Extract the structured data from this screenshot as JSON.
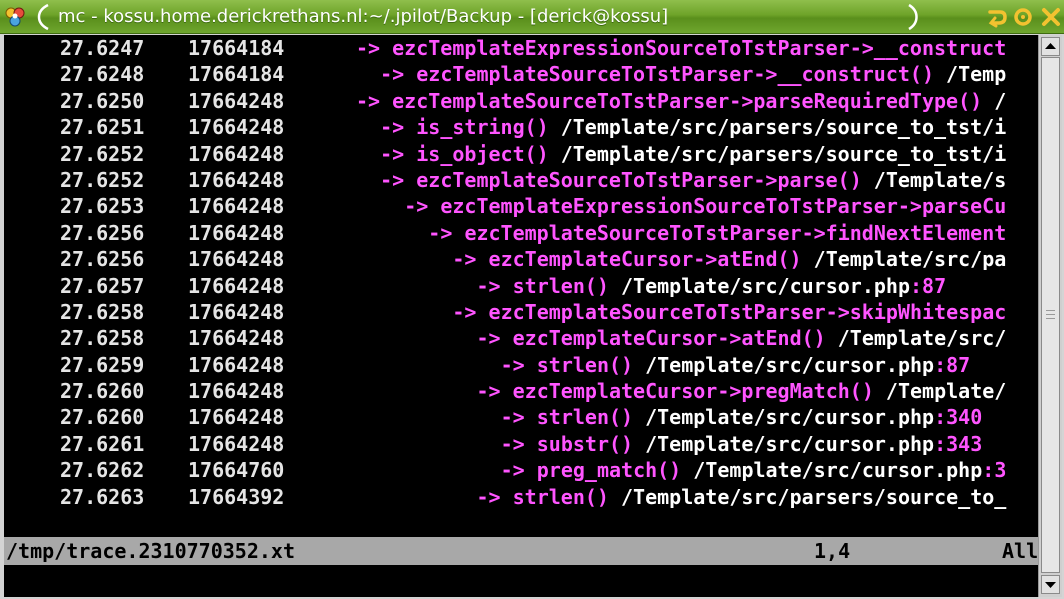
{
  "window": {
    "title": "mc - kossu.home.derickrethans.nl:~/.jpilot/Backup - [derick@kossu]",
    "icons": [
      "app-icon",
      "shade-icon",
      "maximize-icon",
      "close-icon"
    ]
  },
  "terminal": {
    "colors": {
      "background": "#000000",
      "text": "#e5e5e5",
      "magenta": "#ff55ff",
      "white": "#ffffff",
      "status_bg": "#a8a8a8"
    },
    "lines": [
      {
        "time": "27.6247",
        "mem": "17664184",
        "indent": 0,
        "arrow": "->",
        "func": "ezcTemplateExpressionSourceToTstParser->__construct",
        "path": "",
        "colon": "",
        "lineno": ""
      },
      {
        "time": "27.6248",
        "mem": "17664184",
        "indent": 1,
        "arrow": "->",
        "func": "ezcTemplateSourceToTstParser->__construct()",
        "path": " /Temp",
        "colon": "",
        "lineno": ""
      },
      {
        "time": "27.6250",
        "mem": "17664248",
        "indent": 0,
        "arrow": "->",
        "func": "ezcTemplateSourceToTstParser->parseRequiredType()",
        "path": " /",
        "colon": "",
        "lineno": ""
      },
      {
        "time": "27.6251",
        "mem": "17664248",
        "indent": 1,
        "arrow": "->",
        "func": "is_string()",
        "path": " /Template/src/parsers/source_to_tst/i",
        "colon": "",
        "lineno": ""
      },
      {
        "time": "27.6252",
        "mem": "17664248",
        "indent": 1,
        "arrow": "->",
        "func": "is_object()",
        "path": " /Template/src/parsers/source_to_tst/i",
        "colon": "",
        "lineno": ""
      },
      {
        "time": "27.6252",
        "mem": "17664248",
        "indent": 1,
        "arrow": "->",
        "func": "ezcTemplateSourceToTstParser->parse()",
        "path": " /Template/s",
        "colon": "",
        "lineno": ""
      },
      {
        "time": "27.6253",
        "mem": "17664248",
        "indent": 2,
        "arrow": "->",
        "func": "ezcTemplateExpressionSourceToTstParser->parseCu",
        "path": "",
        "colon": "",
        "lineno": ""
      },
      {
        "time": "27.6256",
        "mem": "17664248",
        "indent": 3,
        "arrow": "->",
        "func": "ezcTemplateSourceToTstParser->findNextElement",
        "path": "",
        "colon": "",
        "lineno": ""
      },
      {
        "time": "27.6256",
        "mem": "17664248",
        "indent": 4,
        "arrow": "->",
        "func": "ezcTemplateCursor->atEnd()",
        "path": " /Template/src/pa",
        "colon": "",
        "lineno": ""
      },
      {
        "time": "27.6257",
        "mem": "17664248",
        "indent": 5,
        "arrow": "->",
        "func": "strlen()",
        "path": " /Template/src/cursor.php",
        "colon": ":",
        "lineno": "87"
      },
      {
        "time": "27.6258",
        "mem": "17664248",
        "indent": 4,
        "arrow": "->",
        "func": "ezcTemplateSourceToTstParser->skipWhitespac",
        "path": "",
        "colon": "",
        "lineno": ""
      },
      {
        "time": "27.6258",
        "mem": "17664248",
        "indent": 5,
        "arrow": "->",
        "func": "ezcTemplateCursor->atEnd()",
        "path": " /Template/src/",
        "colon": "",
        "lineno": ""
      },
      {
        "time": "27.6259",
        "mem": "17664248",
        "indent": 6,
        "arrow": "->",
        "func": "strlen()",
        "path": " /Template/src/cursor.php",
        "colon": ":",
        "lineno": "87"
      },
      {
        "time": "27.6260",
        "mem": "17664248",
        "indent": 5,
        "arrow": "->",
        "func": "ezcTemplateCursor->pregMatch()",
        "path": " /Template/",
        "colon": "",
        "lineno": ""
      },
      {
        "time": "27.6260",
        "mem": "17664248",
        "indent": 6,
        "arrow": "->",
        "func": "strlen()",
        "path": " /Template/src/cursor.php",
        "colon": ":",
        "lineno": "340"
      },
      {
        "time": "27.6261",
        "mem": "17664248",
        "indent": 6,
        "arrow": "->",
        "func": "substr()",
        "path": " /Template/src/cursor.php",
        "colon": ":",
        "lineno": "343"
      },
      {
        "time": "27.6262",
        "mem": "17664760",
        "indent": 6,
        "arrow": "->",
        "func": "preg_match()",
        "path": " /Template/src/cursor.php",
        "colon": ":",
        "lineno": "3"
      },
      {
        "time": "27.6263",
        "mem": "17664392",
        "indent": 5,
        "arrow": "->",
        "func": "strlen()",
        "path": " /Template/src/parsers/source_to_",
        "colon": "",
        "lineno": ""
      }
    ],
    "status": {
      "file": "/tmp/trace.2310770352.xt",
      "position": "1,4",
      "scroll": "All"
    }
  }
}
